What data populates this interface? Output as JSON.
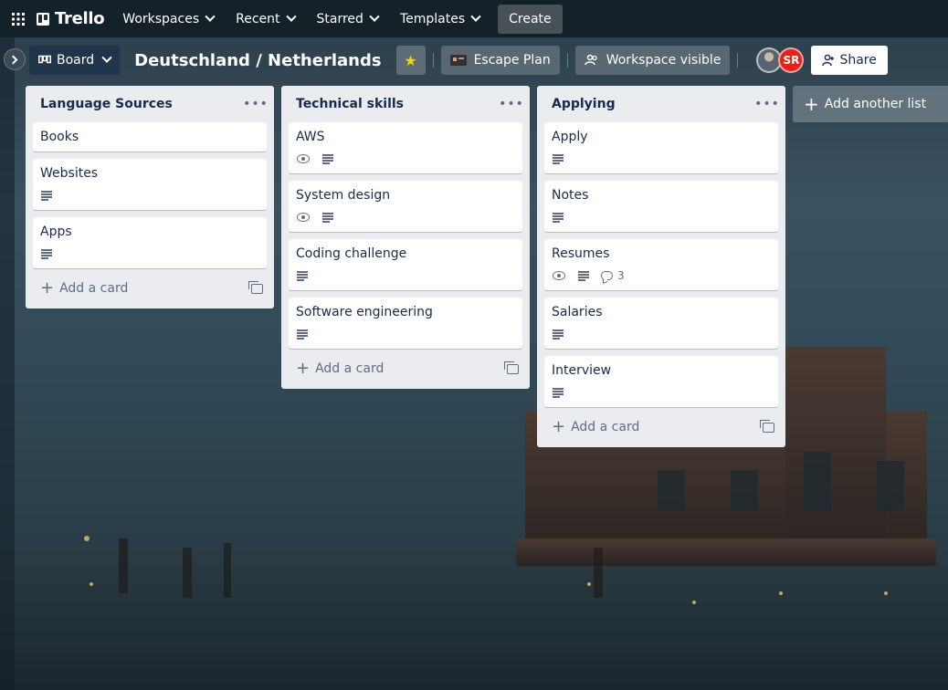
{
  "topbar": {
    "logo_text": "Trello",
    "nav": [
      "Workspaces",
      "Recent",
      "Starred",
      "Templates"
    ],
    "create_label": "Create"
  },
  "board_header": {
    "view_label": "Board",
    "title": "Deutschland / Netherlands",
    "workspace_label": "Escape Plan",
    "visibility_label": "Workspace visible",
    "avatar_initials": "SR",
    "share_label": "Share"
  },
  "lists": [
    {
      "title": "Language Sources",
      "cards": [
        {
          "title": "Books",
          "watch": false,
          "desc": false,
          "comments": ""
        },
        {
          "title": "Websites",
          "watch": false,
          "desc": true,
          "comments": ""
        },
        {
          "title": "Apps",
          "watch": false,
          "desc": true,
          "comments": ""
        }
      ],
      "add_card_label": "Add a card"
    },
    {
      "title": "Technical skills",
      "cards": [
        {
          "title": "AWS",
          "watch": true,
          "desc": true,
          "comments": ""
        },
        {
          "title": "System design",
          "watch": true,
          "desc": true,
          "comments": ""
        },
        {
          "title": "Coding challenge",
          "watch": false,
          "desc": true,
          "comments": ""
        },
        {
          "title": "Software engineering",
          "watch": false,
          "desc": true,
          "comments": ""
        }
      ],
      "add_card_label": "Add a card"
    },
    {
      "title": "Applying",
      "cards": [
        {
          "title": "Apply",
          "watch": false,
          "desc": true,
          "comments": ""
        },
        {
          "title": "Notes",
          "watch": false,
          "desc": true,
          "comments": ""
        },
        {
          "title": "Resumes",
          "watch": true,
          "desc": true,
          "comments": "3"
        },
        {
          "title": "Salaries",
          "watch": false,
          "desc": true,
          "comments": ""
        },
        {
          "title": "Interview",
          "watch": false,
          "desc": true,
          "comments": ""
        }
      ],
      "add_card_label": "Add a card"
    }
  ],
  "add_list_label": "Add another list",
  "colors": {
    "list_bg": "#ebecf0",
    "avatar_sr": "#e2231a",
    "star": "#f2d600"
  }
}
